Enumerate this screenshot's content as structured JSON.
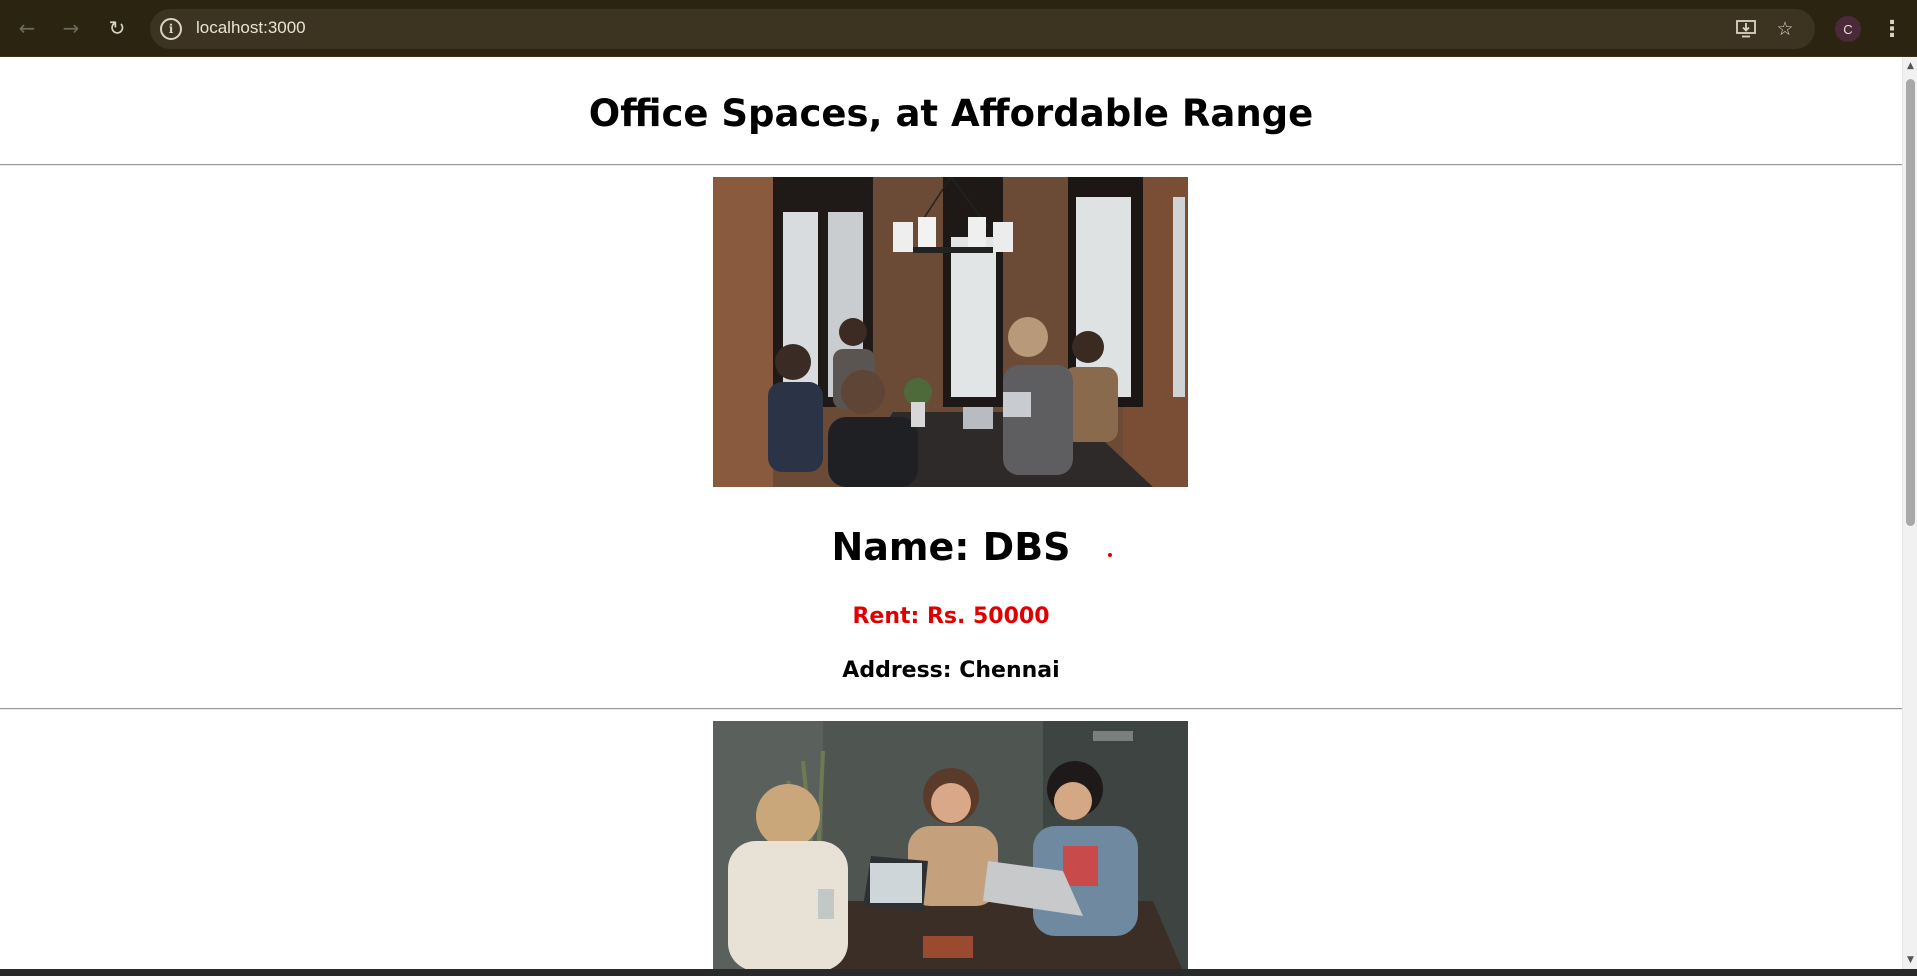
{
  "browser": {
    "url": "localhost:3000",
    "back_icon": "arrow-left-icon",
    "forward_icon": "arrow-right-icon",
    "reload_icon": "reload-icon",
    "info_icon": "info-icon",
    "info_glyph": "i",
    "install_icon": "install-app-icon",
    "bookmark_icon": "star-icon",
    "profile_initial": "C",
    "menu_icon": "more-vertical-icon"
  },
  "page": {
    "title": "Office Spaces, at Affordable Range"
  },
  "offices": [
    {
      "name_line": "Name: DBS",
      "rent_line": "Rent: Rs. 50000",
      "address_line": "Address: Chennai",
      "image_alt": "People working at a table in an office"
    },
    {
      "image_alt": "Three people chatting at a cafe table with laptops"
    }
  ],
  "colors": {
    "rent": "#e00000",
    "chrome_bg": "#2b2410",
    "omnibox_bg": "#3c3421"
  }
}
